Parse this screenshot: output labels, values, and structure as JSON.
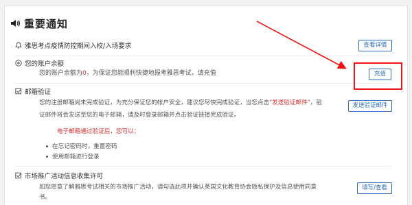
{
  "header": {
    "title": "重要通知"
  },
  "sections": {
    "notice": {
      "label": "雅思考点疫情防控期间入校/入场要求",
      "button": "查看详情"
    },
    "balance": {
      "label": "您的账户余额",
      "desc_prefix": "您的账户余额为",
      "amount": "0",
      "desc_suffix": "，为保证您能顺利快捷地报考雅思考试，请充值",
      "button": "充值"
    },
    "email": {
      "label": "邮箱验证",
      "para_line1_a": "您的注册邮箱尚未完成验证，为充分保证您的帐户安全，建议您尽快完成验证，当您点击",
      "para_line1_link": "\"发送验证邮件\"",
      "para_line1_b": "，验",
      "para_line2": "证邮件将会发送至您的电子邮箱，请及时登录邮箱并点击验证链接完成验证。",
      "after_title": "电子邮箱通过验证后，您可以：",
      "bullets": [
        "在忘记密码时，重置密码",
        "使用邮箱进行登录"
      ],
      "button": "发送验证邮件"
    },
    "marketing": {
      "label": "市场推广活动信息收集许可",
      "para_line1": "如您愿意了解雅思考试相关的市场推广活动，请勾选此项并确认英国文化教育协会隐私保护及信息使用同意",
      "para_line2": "书。",
      "button": "填写/查看"
    }
  },
  "colors": {
    "accent": "#2e6bb8",
    "highlight": "#ee1111",
    "warning_text": "#d62b2b"
  }
}
